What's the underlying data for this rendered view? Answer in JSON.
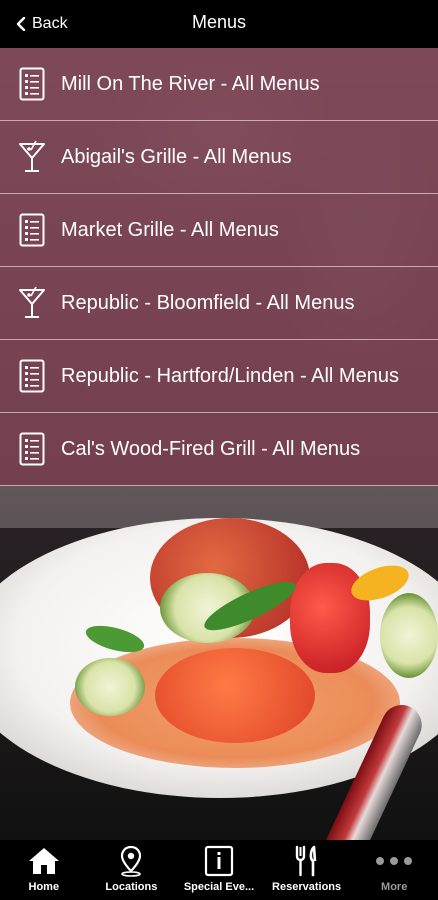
{
  "header": {
    "back_label": "Back",
    "title": "Menus"
  },
  "menus": [
    {
      "label": "Mill On The River - All Menus",
      "icon": "menu-list-icon"
    },
    {
      "label": "Abigail's Grille - All Menus",
      "icon": "martini-glass-icon"
    },
    {
      "label": "Market Grille - All Menus",
      "icon": "menu-list-icon"
    },
    {
      "label": "Republic - Bloomfield - All Menus",
      "icon": "martini-glass-icon"
    },
    {
      "label": "Republic - Hartford/Linden - All Menus",
      "icon": "menu-list-icon"
    },
    {
      "label": "Cal's Wood-Fired Grill - All Menus",
      "icon": "menu-list-icon"
    }
  ],
  "tabbar": {
    "items": [
      {
        "label": "Home",
        "icon": "home-icon"
      },
      {
        "label": "Locations",
        "icon": "map-pin-icon"
      },
      {
        "label": "Special Eve...",
        "icon": "info-card-icon"
      },
      {
        "label": "Reservations",
        "icon": "fork-knife-icon"
      },
      {
        "label": "More",
        "icon": "more-dots-icon"
      }
    ]
  },
  "colors": {
    "row_overlay": "#7a3a4c",
    "bar_background": "#000000",
    "text": "#ffffff"
  }
}
